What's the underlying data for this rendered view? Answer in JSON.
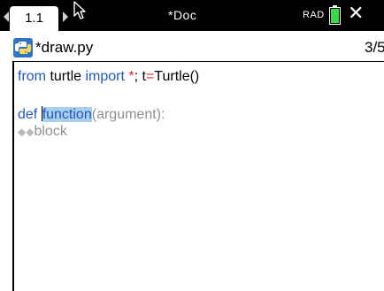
{
  "header": {
    "tab_label": "1.1",
    "doc_title": "*Doc",
    "angle_mode": "RAD",
    "battery_level": 1.0,
    "battery_color": "#3bd94a"
  },
  "file": {
    "name": "*draw.py",
    "page": "3/5"
  },
  "code": {
    "line1": {
      "kw_from": "from",
      "module": " turtle ",
      "kw_import": "import",
      "star": " *",
      "rest1": "; t",
      "eq": "=",
      "rest2": "Turtle()"
    },
    "line2": {
      "kw_def": "def ",
      "name_selected": "function",
      "args": "(argument):"
    },
    "line3": {
      "indent": "◆◆",
      "placeholder": "block"
    }
  },
  "colors": {
    "keyword": "#2456b8",
    "operator": "#cc3333",
    "selection": "#a8cfee",
    "placeholder": "#909090"
  }
}
